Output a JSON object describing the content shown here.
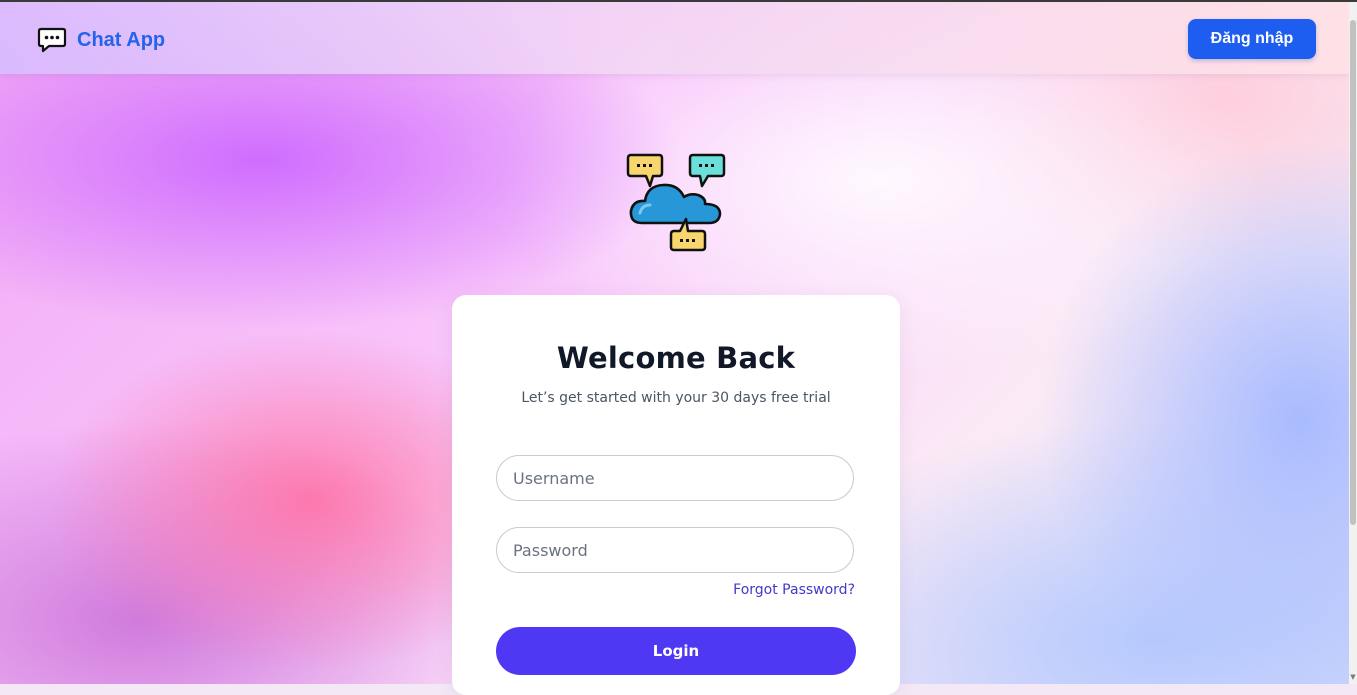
{
  "header": {
    "brand_name": "Chat App",
    "brand_icon": "chat-bubble-icon",
    "login_button_label": "Đăng nhập"
  },
  "logo": {
    "icon": "cloud-chat-icon"
  },
  "card": {
    "title": "Welcome Back",
    "subtitle": "Let’s get started with your 30 days free trial",
    "username_placeholder": "Username",
    "password_placeholder": "Password",
    "forgot_password_label": "Forgot Password?",
    "login_button_label": "Login"
  },
  "colors": {
    "brand": "#2563eb",
    "header_button": "#1d5ef0",
    "login_button": "#4f38f3",
    "link": "#4338ca",
    "title": "#111827"
  }
}
